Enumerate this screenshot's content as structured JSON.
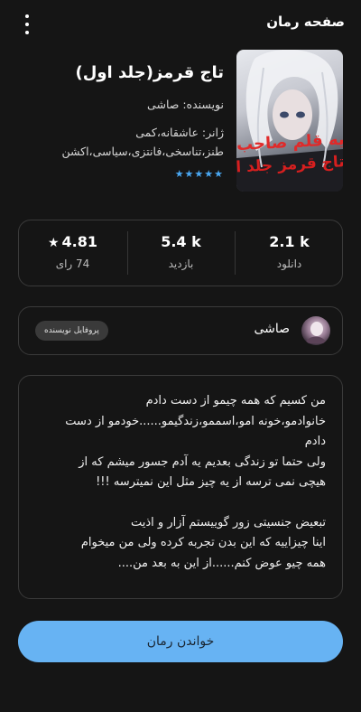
{
  "header": {
    "title": "صفحه رمان",
    "menu_icon": "more-vertical-icon"
  },
  "book": {
    "title": "تاج قرمز(جلد اول)",
    "author_line": "نویسنده: صاشی",
    "genre_line_1": "ژانر: عاشقانه،کمی",
    "genre_line_2": "طنز،تناسخی،فانتزی،سیاسی،اکشن",
    "stars": "★★★★★",
    "cover_text_1": "یه قلم صاحب",
    "cover_text_2": "تاج قرمز جلد اول"
  },
  "stats": {
    "rating_value": "4.81",
    "rating_icon": "star-icon",
    "rating_label": "74 رای",
    "views_value": "5.4 k",
    "views_label": "بازدید",
    "downloads_value": "2.1 k",
    "downloads_label": "دانلود"
  },
  "author": {
    "name": "صاشی",
    "profile_button": "پروفایل نویسنده"
  },
  "description": {
    "line_1": "من کسیم که همه چیمو از دست دادم",
    "line_2": "خانوادمو،خونه امو،اسممو،زندگیمو......خودمو  از دست",
    "line_3": "دادم",
    "line_4": "ولی حتما تو زندگی بعدیم یه آدم جسور میشم که از",
    "line_5": "هیچی نمی ترسه از یه چیز مثل این نمیترسه !!!",
    "line_6": "تبعیض جنسیتی زور گوییستم  آزار و اذیت",
    "line_7": "اینا چیزاییه که این بدن تجربه کرده ولی من میخوام",
    "line_8": "همه چیو عوض کنم......از این به بعد من...."
  },
  "read_button": "خواندن رمان",
  "colors": {
    "background": "#151515",
    "accent": "#67b3f3",
    "card_border": "#3a3a3a"
  }
}
